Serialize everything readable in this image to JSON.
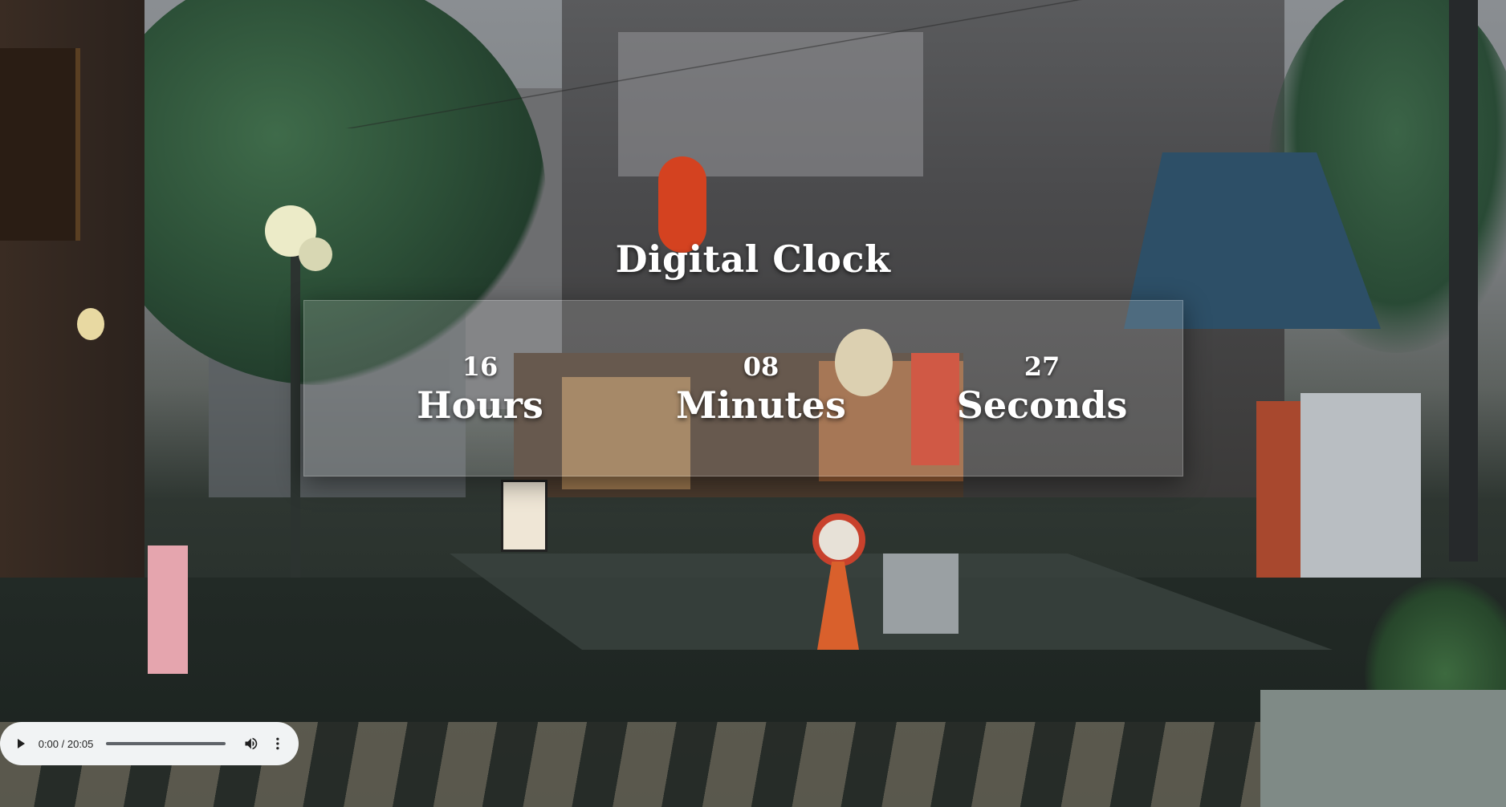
{
  "clock": {
    "title": "Digital Clock",
    "hours": {
      "value": "16",
      "label": "Hours"
    },
    "minutes": {
      "value": "08",
      "label": "Minutes"
    },
    "seconds": {
      "value": "27",
      "label": "Seconds"
    }
  },
  "audio_player": {
    "time": "0:00 / 20:05",
    "progress": 0,
    "icons": {
      "play": "play-icon",
      "volume": "volume-icon",
      "more": "more-options-icon"
    }
  },
  "colors": {
    "text": "#ffffff",
    "panel": "rgba(255,255,255,0.16)",
    "player_bg": "#f1f3f4"
  }
}
